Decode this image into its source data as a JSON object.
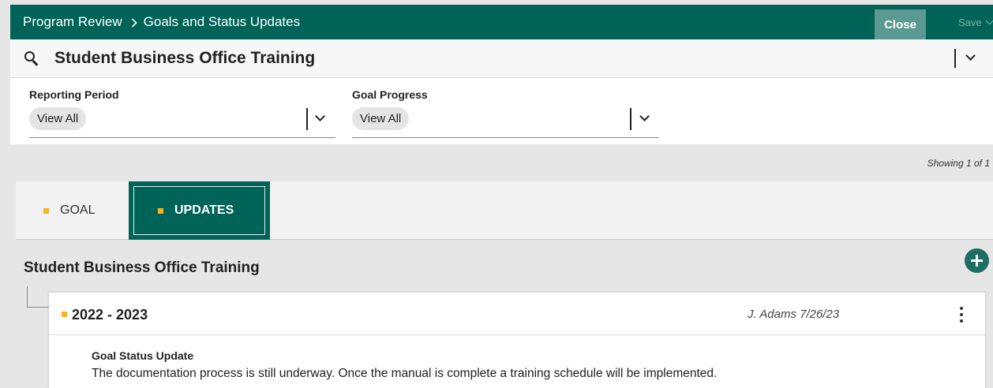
{
  "header": {
    "breadcrumb": [
      "Program Review",
      "Goals and Status Updates"
    ],
    "close_label": "Close",
    "save_label": "Save",
    "color": "#006358"
  },
  "search": {
    "title": "Student Business Office Training"
  },
  "filters": {
    "reporting_period": {
      "label": "Reporting Period",
      "value": "View All"
    },
    "goal_progress": {
      "label": "Goal Progress",
      "value": "View All"
    }
  },
  "results": {
    "showing": "Showing 1 of 1"
  },
  "tabs": [
    {
      "label": "GOAL",
      "active": false
    },
    {
      "label": "UPDATES",
      "active": true
    }
  ],
  "section": {
    "title": "Student Business Office Training"
  },
  "update_card": {
    "year": "2022 - 2023",
    "meta": "J. Adams 7/26/23",
    "label": "Goal Status Update",
    "text": "The documentation process is still underway. Once the manual is complete a training schedule will be implemented."
  },
  "accent_color": "#f5b324"
}
